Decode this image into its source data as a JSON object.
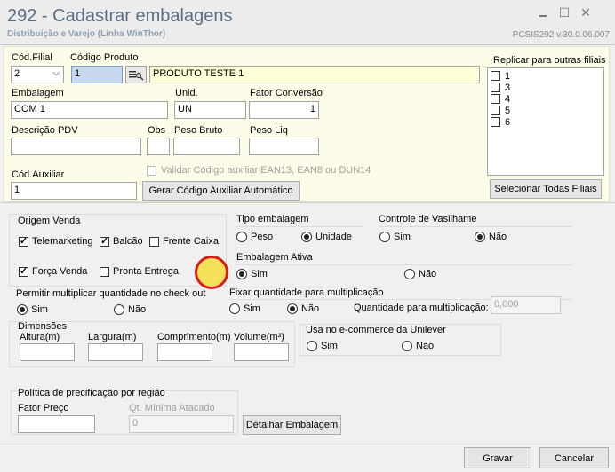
{
  "window": {
    "title": "292 - Cadastrar embalagens",
    "subtitle": "Distribuição e Varejo (Linha WinThor)",
    "version": "PCSIS292  v.30.0.06.007",
    "minimize_glyph": "🗕",
    "maximize_glyph": "☐",
    "close_glyph": "✕"
  },
  "form": {
    "cod_filial_label": "Cód.Filial",
    "cod_filial_value": "2",
    "codigo_produto_label": "Código Produto",
    "codigo_produto_value": "1",
    "produto_nome": "PRODUTO TESTE 1",
    "embalagem_label": "Embalagem",
    "embalagem_value": "COM 1",
    "unid_label": "Unid.",
    "unid_value": "UN",
    "fator_label": "Fator Conversão",
    "fator_value": "1",
    "descricao_label": "Descrição PDV",
    "descricao_value": "",
    "obs_label": "Obs",
    "obs_value": "",
    "peso_bruto_label": "Peso Bruto",
    "peso_bruto_value": "",
    "peso_liq_label": "Peso Liq",
    "peso_liq_value": "",
    "cod_aux_label": "Cód.Auxiliar",
    "cod_aux_value": "1",
    "validar_label": "Validar Código auxiliar EAN13, EAN8 ou DUN14",
    "gerar_button": "Gerar Código Auxiliar Automático"
  },
  "replicar": {
    "title": "Replicar para outras filiais",
    "filiais": [
      "1",
      "3",
      "4",
      "5",
      "6"
    ],
    "selecionar_button": "Selecionar Todas Filiais"
  },
  "origem": {
    "title": "Origem Venda",
    "telemarketing": "Telemarketing",
    "balcao": "Balcão",
    "frente_caixa": "Frente Caixa",
    "forca_venda": "Força Venda",
    "pronta_entrega": "Pronta Entrega"
  },
  "tipo_embalagem": {
    "title": "Tipo embalagem",
    "peso": "Peso",
    "unidade": "Unidade"
  },
  "vasilhame": {
    "title": "Controle de Vasilhame",
    "sim": "Sim",
    "nao": "Não"
  },
  "ativa": {
    "title": "Embalagem Ativa",
    "sim": "Sim",
    "nao": "Não"
  },
  "multiplicar": {
    "title": "Permitir multiplicar quantidade no check out",
    "sim": "Sim",
    "nao": "Não"
  },
  "fixar": {
    "title": "Fixar quantidade para multiplicação",
    "sim": "Sim",
    "nao": "Não",
    "qtd_label": "Quantidade para multiplicação:",
    "qtd_value": "0,000"
  },
  "dimensoes": {
    "title": "Dimensões",
    "altura": "Altura(m)",
    "largura": "Largura(m)",
    "comprimento": "Comprimento(m)",
    "volume": "Volume(m³)"
  },
  "unilever": {
    "title": "Usa no e-commerce da Unilever",
    "sim": "Sim",
    "nao": "Não"
  },
  "politica": {
    "title": "Política de precificação por região",
    "fator_preco": "Fator Preço",
    "qt_minima": "Qt. Mínima Atacado",
    "qt_minima_value": "0",
    "detalhar_button": "Detalhar Embalagem"
  },
  "footer": {
    "gravar": "Gravar",
    "cancelar": "Cancelar"
  },
  "colors": {
    "title": "#5a6f84",
    "top_panel": "#fcfce8",
    "highlight": "#c8d8ee",
    "cursor_ring": "#d81b1b",
    "cursor_fill": "#f5e05a"
  }
}
